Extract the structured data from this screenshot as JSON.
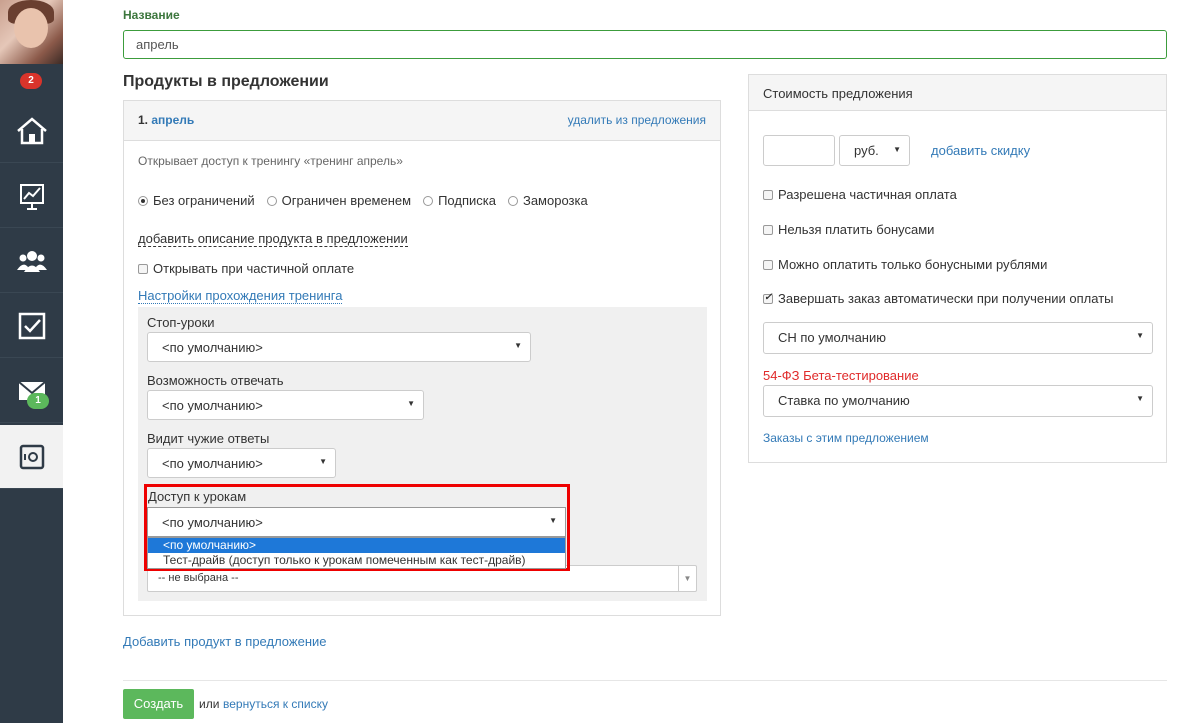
{
  "sidebar": {
    "notifications_count": "2",
    "mail_count": "1",
    "items": [
      {
        "icon": "home-icon"
      },
      {
        "icon": "chart-icon"
      },
      {
        "icon": "users-icon"
      },
      {
        "icon": "checkbox-icon"
      },
      {
        "icon": "mail-icon"
      },
      {
        "icon": "safe-icon"
      }
    ]
  },
  "form": {
    "name_label": "Название",
    "name_value": "апрель",
    "products_title": "Продукты в предложении",
    "add_product": "Добавить продукт в предложение",
    "create_button": "Создать",
    "or_text": "или",
    "back_link": "вернуться к списку"
  },
  "product": {
    "number": "1.",
    "name": "апрель",
    "remove_link": "удалить из предложения",
    "access_text": "Открывает доступ к тренингу «тренинг апрель»",
    "access_options": [
      "Без ограничений",
      "Ограничен временем",
      "Подписка",
      "Заморозка"
    ],
    "selected_access": "Без ограничений",
    "add_description": "добавить описание продукта в предложении",
    "partial_open_label": "Открывать при частичной оплате",
    "training_settings_link": "Настройки прохождения тренинга",
    "stop_lessons_label": "Стоп-уроки",
    "stop_lessons_value": "<по умолчанию>",
    "can_answer_label": "Возможность отвечать",
    "can_answer_value": "<по умолчанию>",
    "sees_others_label": "Видит чужие ответы",
    "sees_others_value": "<по умолчанию>",
    "lesson_access_label": "Доступ к урокам",
    "lesson_access_value": "<по умолчанию>",
    "lesson_access_options": [
      "<по умолчанию>",
      "Тест-драйв (доступ только к урокам помеченным как тест-драйв)"
    ],
    "extra_select_value": "-- не выбрана --"
  },
  "cost": {
    "title": "Стоимость предложения",
    "price_value": "",
    "currency": "руб.",
    "add_discount": "добавить скидку",
    "partial_payment": "Разрешена частичная оплата",
    "no_bonus": "Нельзя платить бонусами",
    "only_bonus": "Можно оплатить только бонусными рублями",
    "auto_complete": "Завершать заказ автоматически при получении оплаты",
    "auto_complete_checked": true,
    "sn_select": "СН по умолчанию",
    "fz_label": "54-ФЗ Бета-тестирование",
    "fz_color": "#e02a2a",
    "rate_select": "Ставка по умолчанию",
    "orders_link": "Заказы с этим предложением"
  }
}
